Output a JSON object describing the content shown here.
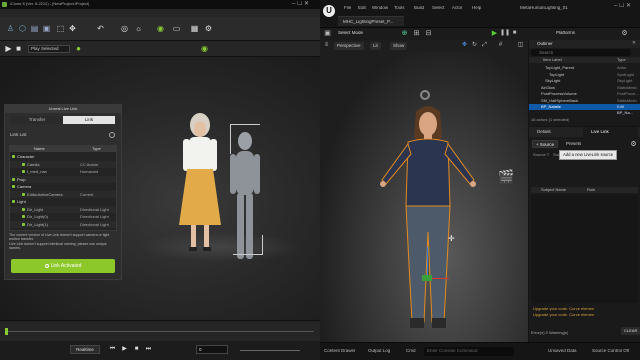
{
  "left_app": {
    "title": "iClone 8 (Ver. 8.2212) - [NewProject.iProject]",
    "menu": [
      "File",
      "Edit",
      "Create",
      "Modify",
      "Animation",
      "Render",
      "View",
      "Window",
      "Plugins",
      "Script",
      "Help"
    ],
    "play_mode": "Play Selected",
    "live_link": {
      "title": "Unreal Live Link",
      "tabs": [
        "Transfer",
        "Link"
      ],
      "active_tab": "Link",
      "link_list_label": "Link List",
      "columns": [
        "Name",
        "Type"
      ],
      "rows": [
        {
          "name": "Character",
          "type": "",
          "indent": 0
        },
        {
          "name": "Camila",
          "type": "CC Avatar",
          "indent": 2
        },
        {
          "name": "f_med_nrw",
          "type": "Humanoid",
          "indent": 2
        },
        {
          "name": "Prop",
          "type": "",
          "indent": 0
        },
        {
          "name": "Camera",
          "type": "",
          "indent": 0
        },
        {
          "name": "EditorActiveCamera",
          "type": "Current",
          "indent": 2
        },
        {
          "name": "Light",
          "type": "",
          "indent": 0
        },
        {
          "name": "Dir_Light",
          "type": "Directional Light",
          "indent": 2
        },
        {
          "name": "Dir_Light(0)",
          "type": "Directional Light",
          "indent": 2
        },
        {
          "name": "Dir_Light(1)",
          "type": "Directional Light",
          "indent": 2
        }
      ],
      "note": "The current version of Live Link doesn't support camera or light motion transfer.\nLive Link doesn't support identical naming, please use unique names.",
      "button": "Link Activated"
    },
    "timeline": {
      "mode": "Realtime",
      "frame": "0"
    }
  },
  "right_app": {
    "project": "MetaHumanLighting_01",
    "tab": "MHC_LightingPreset_P...",
    "menu": [
      "File",
      "Edit",
      "Window",
      "Tools",
      "Build",
      "Select",
      "Actor",
      "Help"
    ],
    "select_mode": "Select Mode",
    "platforms": "Platforms",
    "viewport": {
      "perspective": "Perspective",
      "lit": "Lit",
      "show": "Show"
    },
    "outliner": {
      "title": "Outliner",
      "search": "Search",
      "columns": [
        "Item Label",
        "Type"
      ],
      "rows": [
        {
          "name": "TopLight_Parent",
          "type": "Actor",
          "indent": 3
        },
        {
          "name": "TopLight",
          "type": "SpotLight",
          "indent": 4
        },
        {
          "name": "SkyLight",
          "type": "SkyLight",
          "indent": 3
        },
        {
          "name": "AirGlow",
          "type": "StaticMesh",
          "indent": 2
        },
        {
          "name": "PostProcessVolume",
          "type": "PostProce...",
          "indent": 2
        },
        {
          "name": "SM_HalfSphereBack",
          "type": "StaticMesh",
          "indent": 2
        },
        {
          "name": "BP_Natalie",
          "type": "Edit BP_Na...",
          "indent": 2,
          "selected": true
        }
      ],
      "footer": "16 actors (1 selected)"
    },
    "details": {
      "tabs": [
        "Details",
        "Live Link"
      ],
      "source_btn": "+ Source",
      "presets_btn": "Presets",
      "tooltip": "Add a new LiveLink source",
      "source_type": "Source T",
      "source_col2": "Sour",
      "subject_cols": [
        "Subject Name",
        "Role"
      ],
      "log": [
        "Upgrade your code. Curve elemen",
        "Upgrade your code. Curve elemen"
      ],
      "errors": "Error(s) 0 Warning(s)",
      "clear": "CLEAR"
    },
    "status": {
      "content_drawer": "Content Drawer",
      "output_log": "Output Log",
      "cmd": "Cmd",
      "cmd_placeholder": "Enter Console Command",
      "unsaved": "Unsaved Data",
      "source_control": "Source Control Off"
    }
  }
}
